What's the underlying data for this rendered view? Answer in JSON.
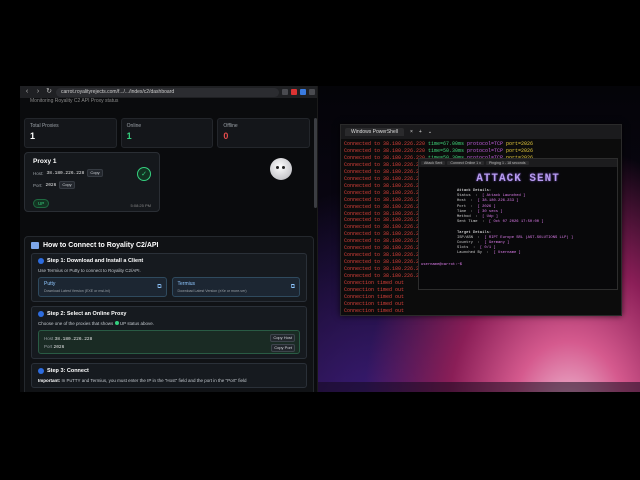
{
  "browser": {
    "url": "carrot.royalityrejects.com/f.../.../index/c2/dashboard",
    "page_top_hint": "Monitoring Royality C2 API Proxy status",
    "stats": [
      {
        "label": "Total Proxies",
        "value": "1",
        "color": "white"
      },
      {
        "label": "Online",
        "value": "1",
        "color": "green"
      },
      {
        "label": "Offline",
        "value": "0",
        "color": "red"
      }
    ],
    "proxy_card": {
      "title": "Proxy 1",
      "host_label": "Host:",
      "host_value": "38.180.226.228",
      "port_label": "Port:",
      "port_value": "2026",
      "copy_label": "Copy",
      "status": "UP",
      "time": "5:08:25 PM"
    },
    "connect": {
      "heading": "How to Connect to Royality C2/API",
      "step1_title": "Step 1: Download and Install a Client",
      "step1_desc": "Use Termius or Putty to connect to Royality C2/API.",
      "clients": [
        {
          "name": "Putty",
          "download": "Download Latest Version (EXE or msi-ini)"
        },
        {
          "name": "Termius",
          "download": "Download Latest Version (eXe or more-ver)"
        }
      ],
      "step2_title": "Step 2: Select an Online Proxy",
      "step2_desc": "Choose one of the proxies that shows",
      "step2_desc_after": "UP status above.",
      "host_label": "Host",
      "host_value": "38.180.226.228",
      "port_label": "Port",
      "port_value": "2026",
      "copy_host": "Copy Host",
      "copy_port": "Copy Port",
      "step3_title": "Step 3: Connect",
      "step3_important": "Important:",
      "step3_desc": "In PuTTY and Termius, you must enter the IP in the \"Host\" field and the port in the \"Port\" field"
    }
  },
  "powershell": {
    "tab_title": "Windows PowerShell",
    "lines": [
      {
        "text": "Connected to 38.180.226.220 time=67.00ms protocol=TCP port=2026",
        "color": "red"
      },
      {
        "text": "Connected to 38.180.226.220 time=50.30ms protocol=TCP port=2026",
        "color": "red"
      },
      {
        "text": "Connected to 38.180.226.220 time=50.30ms protocol=TCP port=2026",
        "color": "red"
      },
      {
        "text": "Connected to 38.180.226.22",
        "color": "red"
      },
      {
        "text": "Connected to 38.180.226.22",
        "color": "red"
      },
      {
        "text": "Connected to 38.180.226.22",
        "color": "red"
      },
      {
        "text": "Connected to 38.180.226.22",
        "color": "red"
      },
      {
        "text": "Connected to 38.180.226.22",
        "color": "red"
      },
      {
        "text": "Connected to 38.180.226.22",
        "color": "red"
      },
      {
        "text": "Connected to 38.180.226.22",
        "color": "red"
      },
      {
        "text": "Connected to 38.180.226.22",
        "color": "red"
      },
      {
        "text": "Connected to 38.180.226.22",
        "color": "red"
      },
      {
        "text": "Connected to 38.180.226.22",
        "color": "red"
      },
      {
        "text": "Connected to 38.180.226.22",
        "color": "red"
      },
      {
        "text": "Connected to 38.180.226.22",
        "color": "red"
      },
      {
        "text": "Connected to 38.180.226.22",
        "color": "red"
      },
      {
        "text": "Connected to 38.180.226.22",
        "color": "red"
      },
      {
        "text": "Connected to 38.180.226.22",
        "color": "red"
      },
      {
        "text": "Connected to 38.180.226.22",
        "color": "red"
      },
      {
        "text": "Connected to 38.180.226.22",
        "color": "red"
      },
      {
        "text": "Connection timed out",
        "color": "red"
      },
      {
        "text": "Connection timed out",
        "color": "red"
      },
      {
        "text": "Connection timed out",
        "color": "red"
      },
      {
        "text": "Connection timed out",
        "color": "red"
      },
      {
        "text": "Connection timed out",
        "color": "red"
      }
    ]
  },
  "attack_window": {
    "tabs": [
      "Attack Sent",
      "Connect Online 1 x",
      "Pinging 1 - 18 seconds"
    ],
    "title": "ATTACK SENT",
    "details_heading": "Attack Details:",
    "details": [
      {
        "k": "Status",
        "v": "[ Attack Launched ]"
      },
      {
        "k": "Host",
        "v": "[ 38.180.226.233 ]"
      },
      {
        "k": "Port",
        "v": "[ 2026 ]"
      },
      {
        "k": "Time",
        "v": "[ 30 secs ]"
      },
      {
        "k": "Method",
        "v": "[ Udp ]"
      },
      {
        "k": "Sent Time",
        "v": "[ Oct 07 2026 17:50:00 ]"
      }
    ],
    "target_heading": "Target Details:",
    "target": [
      {
        "k": "ISP/ASN",
        "v": "[ RIPT Europe SRL (AST-SOLUTIONS LLP) ]"
      },
      {
        "k": "Country",
        "v": "[ Germany ]"
      },
      {
        "k": "Slots",
        "v": "[ 0/1 ]"
      },
      {
        "k": "Launched By",
        "v": "[ Username ]"
      }
    ],
    "prompt": "username@carrot:~$"
  }
}
